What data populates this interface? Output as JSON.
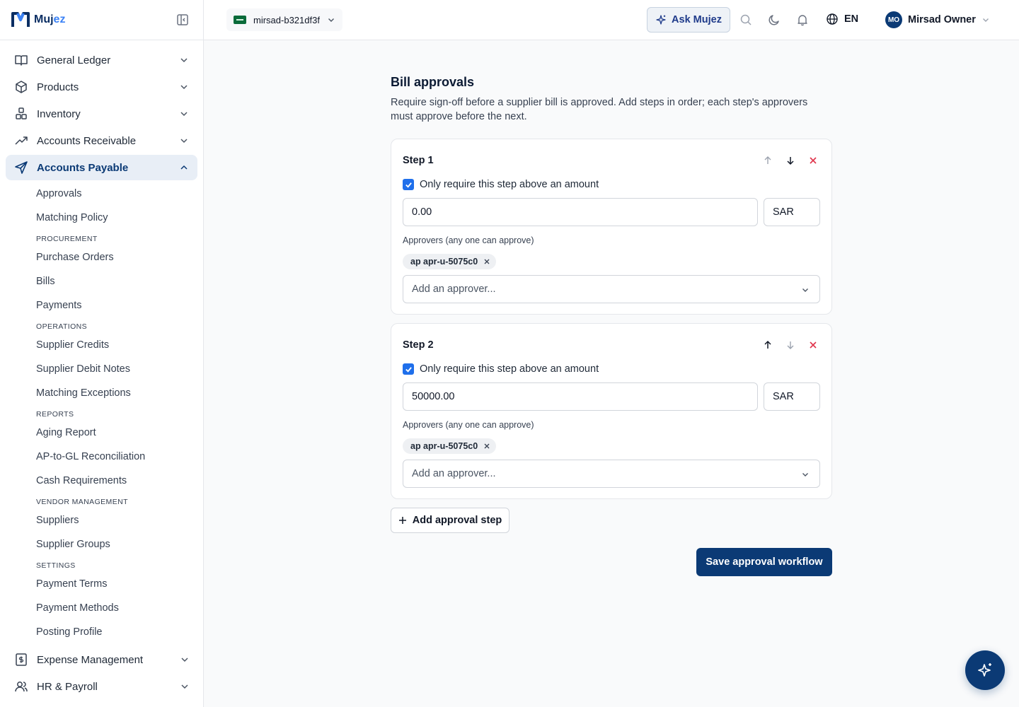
{
  "brand": {
    "name_prefix": "Muj",
    "name_suffix": "ez"
  },
  "sidebar": {
    "top_items": [
      {
        "label": "General Ledger"
      },
      {
        "label": "Products"
      },
      {
        "label": "Inventory"
      },
      {
        "label": "Accounts Receivable"
      }
    ],
    "active_item": {
      "label": "Accounts Payable"
    },
    "sub": {
      "approvals": "Approvals",
      "matching_policy": "Matching Policy",
      "procurement": "PROCUREMENT",
      "purchase_orders": "Purchase Orders",
      "bills": "Bills",
      "payments": "Payments",
      "operations": "OPERATIONS",
      "supplier_credits": "Supplier Credits",
      "supplier_debit_notes": "Supplier Debit Notes",
      "matching_exceptions": "Matching Exceptions",
      "reports": "REPORTS",
      "aging_report": "Aging Report",
      "ap_gl": "AP-to-GL Reconciliation",
      "cash_requirements": "Cash Requirements",
      "vendor_management": "VENDOR MANAGEMENT",
      "suppliers": "Suppliers",
      "supplier_groups": "Supplier Groups",
      "settings": "SETTINGS",
      "payment_terms": "Payment Terms",
      "payment_methods": "Payment Methods",
      "posting_profile": "Posting Profile"
    },
    "bottom_items": [
      {
        "label": "Expense Management"
      },
      {
        "label": "HR & Payroll"
      }
    ]
  },
  "topbar": {
    "tenant": "mirsad-b321df3f",
    "ask_label": "Ask Mujez",
    "language": "EN",
    "avatar_initials": "MO",
    "user_name": "Mirsad Owner"
  },
  "page": {
    "title": "Bill approvals",
    "description": "Require sign-off before a supplier bill is approved. Add steps in order; each step's approvers must approve before the next."
  },
  "steps": [
    {
      "title": "Step 1",
      "threshold_label": "Only require this step above an amount",
      "threshold_checked": true,
      "amount": "0.00",
      "currency": "SAR",
      "approvers_label": "Approvers (any one can approve)",
      "approver_chip": "ap apr-u-5075c0",
      "add_approver_placeholder": "Add an approver..."
    },
    {
      "title": "Step 2",
      "threshold_label": "Only require this step above an amount",
      "threshold_checked": true,
      "amount": "50000.00",
      "currency": "SAR",
      "approvers_label": "Approvers (any one can approve)",
      "approver_chip": "ap apr-u-5075c0",
      "add_approver_placeholder": "Add an approver..."
    }
  ],
  "actions": {
    "add_step": "Add approval step",
    "save": "Save approval workflow"
  },
  "colors": {
    "primary": "#0b3a75",
    "checkbox": "#1f6feb",
    "danger": "#e0344b",
    "active_nav_bg": "#e8eef6"
  }
}
